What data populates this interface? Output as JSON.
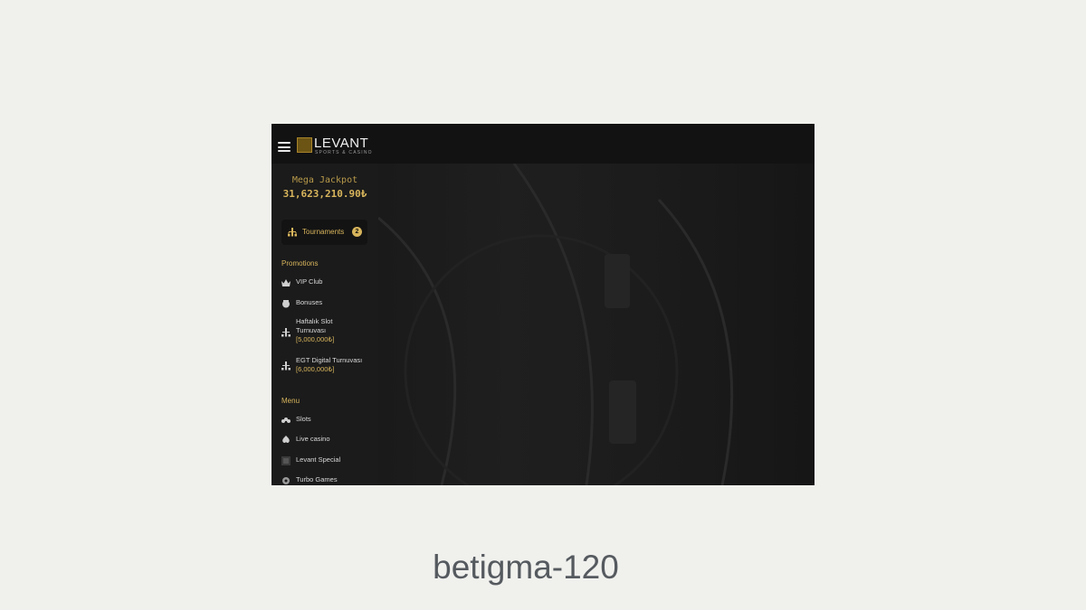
{
  "header": {
    "logo_text": "LEVANT",
    "logo_subtitle": "SPORTS & CASINO"
  },
  "jackpot": {
    "title": "Mega Jackpot",
    "amount": "31,623,210.90₺"
  },
  "tournaments": {
    "label": "Tournaments",
    "count": "2"
  },
  "promotions": {
    "title": "Promotions",
    "items": [
      {
        "label": "VIP Club",
        "icon": "crown-icon"
      },
      {
        "label": "Bonuses",
        "icon": "gift-icon"
      },
      {
        "label": "Haftalık Slot Turnuvası",
        "sub": "[5,000,000₺]",
        "icon": "tournament-icon"
      },
      {
        "label": "EGT Digital Turnuvası",
        "sub": "[6,000,000₺]",
        "icon": "tournament-icon"
      }
    ]
  },
  "menu": {
    "title": "Menu",
    "items": [
      {
        "label": "Slots",
        "icon": "slots-icon"
      },
      {
        "label": "Live casino",
        "icon": "spade-icon"
      },
      {
        "label": "Levant Special",
        "icon": "levant-special-icon"
      },
      {
        "label": "Turbo Games",
        "icon": "turbo-icon"
      }
    ]
  },
  "caption": "betigma-120",
  "colors": {
    "accent": "#d8b55c",
    "sidebar_bg": "#1b1b1b",
    "page_bg": "#f0f0ed"
  }
}
